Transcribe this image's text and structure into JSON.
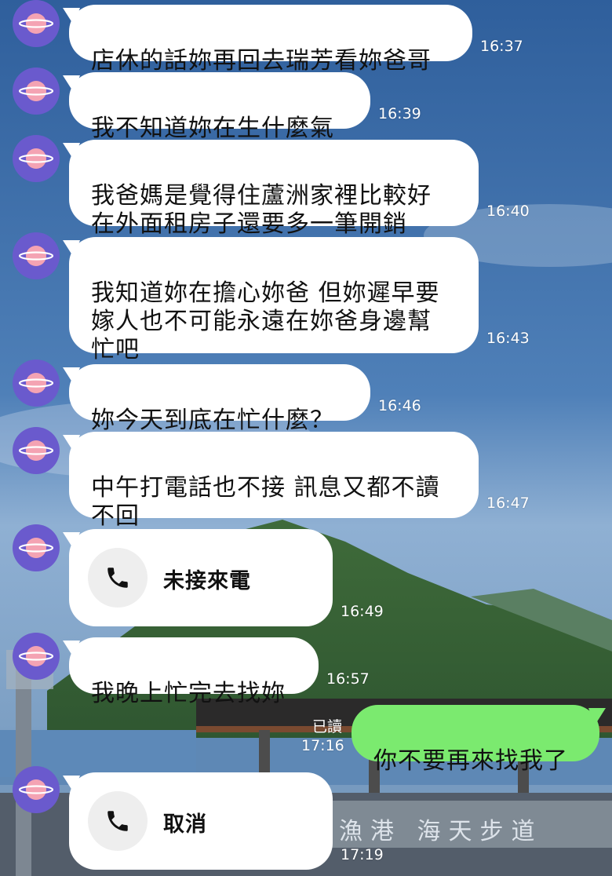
{
  "messages": [
    {
      "text": "店休的話妳再回去瑞芳看妳爸哥",
      "time": "16:37"
    },
    {
      "text": "我不知道妳在生什麼氣",
      "time": "16:39"
    },
    {
      "text": "我爸媽是覺得住蘆洲家裡比較好\n在外面租房子還要多一筆開銷",
      "time": "16:40"
    },
    {
      "text": "我知道妳在擔心妳爸 但妳遲早要\n嫁人也不可能永遠在妳爸身邊幫\n忙吧",
      "time": "16:43"
    },
    {
      "text": "妳今天到底在忙什麼？",
      "time": "16:46"
    },
    {
      "text": "中午打電話也不接 訊息又都不讀\n不回",
      "time": "16:47"
    },
    {
      "call": "未接來電",
      "time": "16:49",
      "icon": "phone-icon"
    },
    {
      "text": "我晚上忙完去找妳",
      "time": "16:57"
    },
    {
      "text": "你不要再來找我了",
      "time": "17:16",
      "read": "已讀",
      "outgoing": true
    },
    {
      "call": "取消",
      "time": "17:19",
      "icon": "phone-icon"
    }
  ],
  "background_sign": "漁港 海天步道",
  "colors": {
    "outgoing_bubble": "#7bea6f",
    "incoming_bubble": "#ffffff",
    "avatar": "#6a5acd"
  }
}
